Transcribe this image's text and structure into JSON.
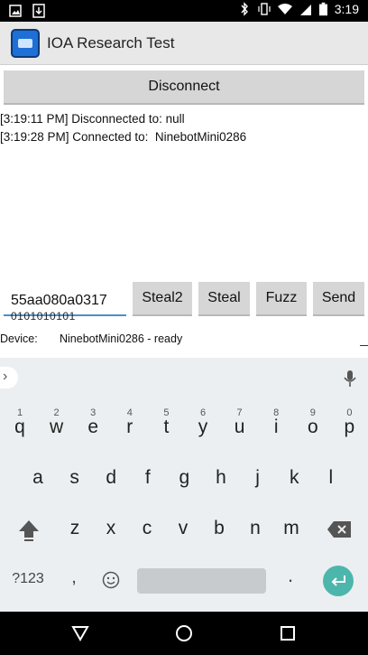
{
  "statusbar": {
    "time": "3:19"
  },
  "app": {
    "title": "IOA Research Test"
  },
  "disconnect_label": "Disconnect",
  "log": [
    "[3:19:11 PM] Disconnected to: null",
    "[3:19:28 PM] Connected to:  NinebotMini0286"
  ],
  "command": {
    "value": "55aa080a0317",
    "overflow_text": "0101010101"
  },
  "buttons": {
    "steal2": "Steal2",
    "steal": "Steal",
    "fuzz": "Fuzz",
    "send": "Send"
  },
  "device": {
    "label": "Device:",
    "value": "NinebotMini0286 - ready"
  },
  "keyboard": {
    "row1": [
      {
        "k": "q",
        "h": "1"
      },
      {
        "k": "w",
        "h": "2"
      },
      {
        "k": "e",
        "h": "3"
      },
      {
        "k": "r",
        "h": "4"
      },
      {
        "k": "t",
        "h": "5"
      },
      {
        "k": "y",
        "h": "6"
      },
      {
        "k": "u",
        "h": "7"
      },
      {
        "k": "i",
        "h": "8"
      },
      {
        "k": "o",
        "h": "9"
      },
      {
        "k": "p",
        "h": "0"
      }
    ],
    "row2": [
      "a",
      "s",
      "d",
      "f",
      "g",
      "h",
      "j",
      "k",
      "l"
    ],
    "row3": [
      "z",
      "x",
      "c",
      "v",
      "b",
      "n",
      "m"
    ],
    "symbols_label": "?123",
    "comma": ",",
    "period": "."
  },
  "colors": {
    "accent": "#4a90c8",
    "enter": "#4db6ac",
    "button_bg": "#d6d6d6"
  }
}
